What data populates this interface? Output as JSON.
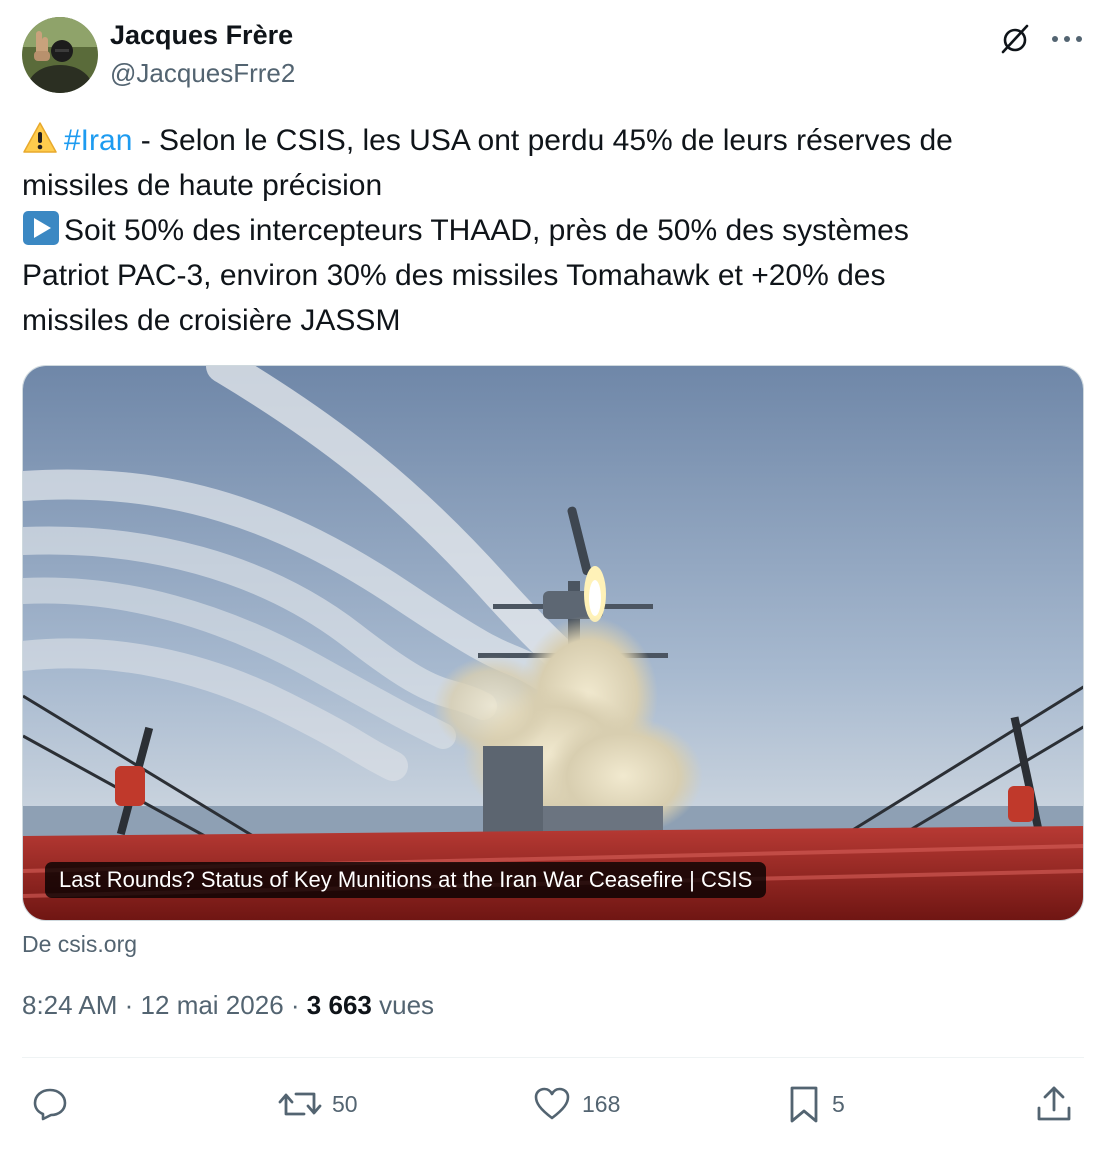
{
  "author": {
    "display_name": "Jacques Frère",
    "handle": "@JacquesFrre2",
    "avatar_icon": "avatar-photo"
  },
  "header_icons": {
    "grok": "grok-slash-circle-icon",
    "more": "more-dots-icon"
  },
  "tweet": {
    "line1_emoji": "warning-emoji",
    "hashtag": "#Iran",
    "line1_text": " - Selon le CSIS, les USA ont perdu 45% de leurs réserves de",
    "line2": "missiles de haute précision",
    "line3_emoji": "play-button-emoji",
    "line3_text": "Soit 50% des intercepteurs THAAD, près de 50% des systèmes",
    "line4": "Patriot PAC-3, environ 30% des missiles Tomahawk et +20% des",
    "line5": "missiles de croisière JASSM"
  },
  "card": {
    "caption": "Last Rounds? Status of Key Munitions at the Iran War Ceasefire | CSIS",
    "source": "De csis.org"
  },
  "meta": {
    "time": "8:24 AM",
    "date": "12 mai 2026",
    "separator": "·",
    "views_count": "3 663",
    "views_label": "vues"
  },
  "actions": {
    "replies": "",
    "reposts": "50",
    "likes": "168",
    "bookmarks": "5"
  },
  "colors": {
    "text_primary": "#0f1419",
    "text_secondary": "#536471",
    "link": "#1d9bf0",
    "divider": "#eff3f4"
  }
}
